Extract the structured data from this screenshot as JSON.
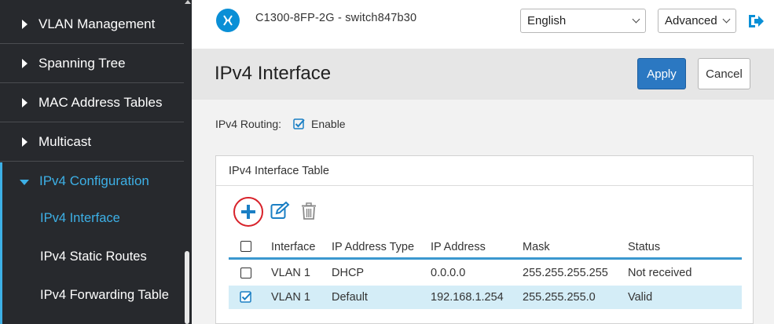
{
  "sidebar": {
    "items": [
      {
        "label": "VLAN Management"
      },
      {
        "label": "Spanning Tree"
      },
      {
        "label": "MAC Address Tables"
      },
      {
        "label": "Multicast"
      },
      {
        "label": "IPv4 Configuration"
      }
    ],
    "subitems": [
      {
        "label": "IPv4 Interface"
      },
      {
        "label": "IPv4 Static Routes"
      },
      {
        "label": "IPv4 Forwarding Table"
      }
    ]
  },
  "header": {
    "device": "C1300-8FP-2G - switch847b30",
    "language": "English",
    "mode": "Advanced"
  },
  "page": {
    "title": "IPv4 Interface",
    "apply": "Apply",
    "cancel": "Cancel"
  },
  "routing": {
    "label": "IPv4 Routing:",
    "enable": "Enable",
    "checked": true
  },
  "table": {
    "title": "IPv4 Interface Table",
    "columns": [
      "Interface",
      "IP Address Type",
      "IP Address",
      "Mask",
      "Status"
    ],
    "rows": [
      {
        "interface": "VLAN 1",
        "type": "DHCP",
        "ip": "0.0.0.0",
        "mask": "255.255.255.255",
        "status": "Not received",
        "checked": false
      },
      {
        "interface": "VLAN 1",
        "type": "Default",
        "ip": "192.168.1.254",
        "mask": "255.255.255.0",
        "status": "Valid",
        "checked": true
      }
    ]
  },
  "colors": {
    "accent": "#3db0e6",
    "primary_button": "#2b78c2",
    "highlight_circle": "#d8222a",
    "selected_row": "#d4edf7"
  }
}
